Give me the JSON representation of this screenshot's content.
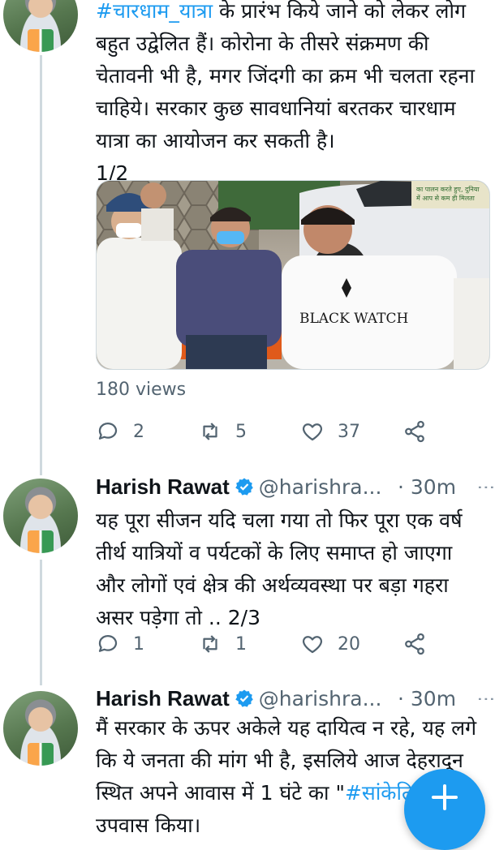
{
  "tweets": [
    {
      "text_hashtag": "#चारधाम_यात्रा",
      "text_line1_rest": " के प्रारंभ किये जाने को लेकर लोग",
      "text_rest": "बहुत उद्वेलित हैं। कोरोना के तीसरे संक्रमण की\nचेतावनी भी है, मगर जिंदगी का क्रम भी चलता रहना\nचाहिये। सरकार कुछ सावधानियां बरतकर चारधाम\nयात्रा का आयोजन कर सकती है।\n1/2",
      "image_text": {
        "shirt_text": "BLACK WATCH",
        "sign_text": "का पालन करते हुए, दुनिया\nमें आप से कम ही मिलता"
      },
      "views": "180 views",
      "replies": "2",
      "retweets": "5",
      "likes": "37"
    },
    {
      "name": "Harish Rawat",
      "handle": "@harishra...",
      "time": "· 30m",
      "text": "यह पूरा सीजन यदि चला गया तो फिर पूरा एक वर्ष\nतीर्थ यात्रियों व पर्यटकों के लिए समाप्त हो जाएगा\nऔर लोगों एवं क्षेत्र की अर्थव्यवस्था पर बड़ा गहरा\nअसर पड़ेगा तो .. 2/3",
      "replies": "1",
      "retweets": "1",
      "likes": "20"
    },
    {
      "name": "Harish Rawat",
      "handle": "@harishra...",
      "time": "· 30m",
      "text_part1": "मैं सरकार के ऊपर अकेले यह दायित्व न रहे, यह लगे\nकि ये जनता की मांग भी है, इसलिये आज देहरादून\nस्थित अपने आवास में 1 घंटे का \"",
      "text_hashtag": "#सांकेति",
      "text_part2": "     \"\nउपवास किया।"
    }
  ],
  "icons": {
    "reply": "reply-icon",
    "retweet": "retweet-icon",
    "like": "heart-icon",
    "share": "share-icon",
    "verified": "verified-badge-icon",
    "more": "more-options-icon",
    "compose": "compose-plus-icon"
  },
  "colors": {
    "accent": "#1d9bf0",
    "muted": "#536471",
    "thread_line": "#cfd9de"
  }
}
